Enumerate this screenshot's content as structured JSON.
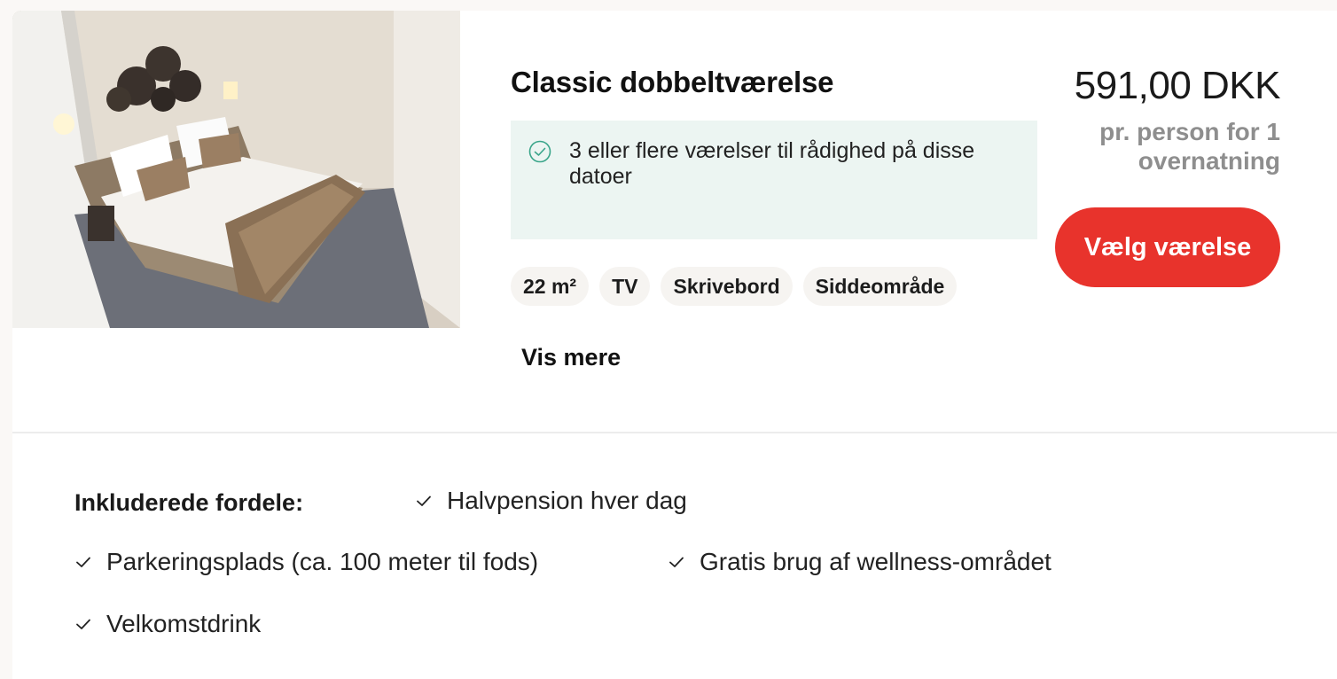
{
  "room": {
    "title": "Classic dobbeltværelse",
    "availability": "3 eller flere værelser til rådighed på disse datoer",
    "features": [
      "22 m²",
      "TV",
      "Skrivebord",
      "Siddeområde"
    ],
    "show_more": "Vis mere"
  },
  "pricing": {
    "price": "591,00 DKK",
    "note": "pr. person for 1 overnatning",
    "select_label": "Vælg værelse"
  },
  "benefits": {
    "label": "Inkluderede fordele:",
    "items": [
      "Halvpension hver dag",
      "Parkeringsplads (ca. 100 meter til fods)",
      "Gratis brug af wellness-området",
      "Velkomstdrink"
    ]
  },
  "colors": {
    "accent": "#e8332c",
    "availability_bg": "#ecf5f2",
    "availability_icon": "#3aa58a",
    "chip_bg": "#f6f4f1",
    "muted_text": "#8e8e8e"
  },
  "icons": {
    "availability": "check-circle-icon",
    "benefit": "checkmark-icon"
  }
}
